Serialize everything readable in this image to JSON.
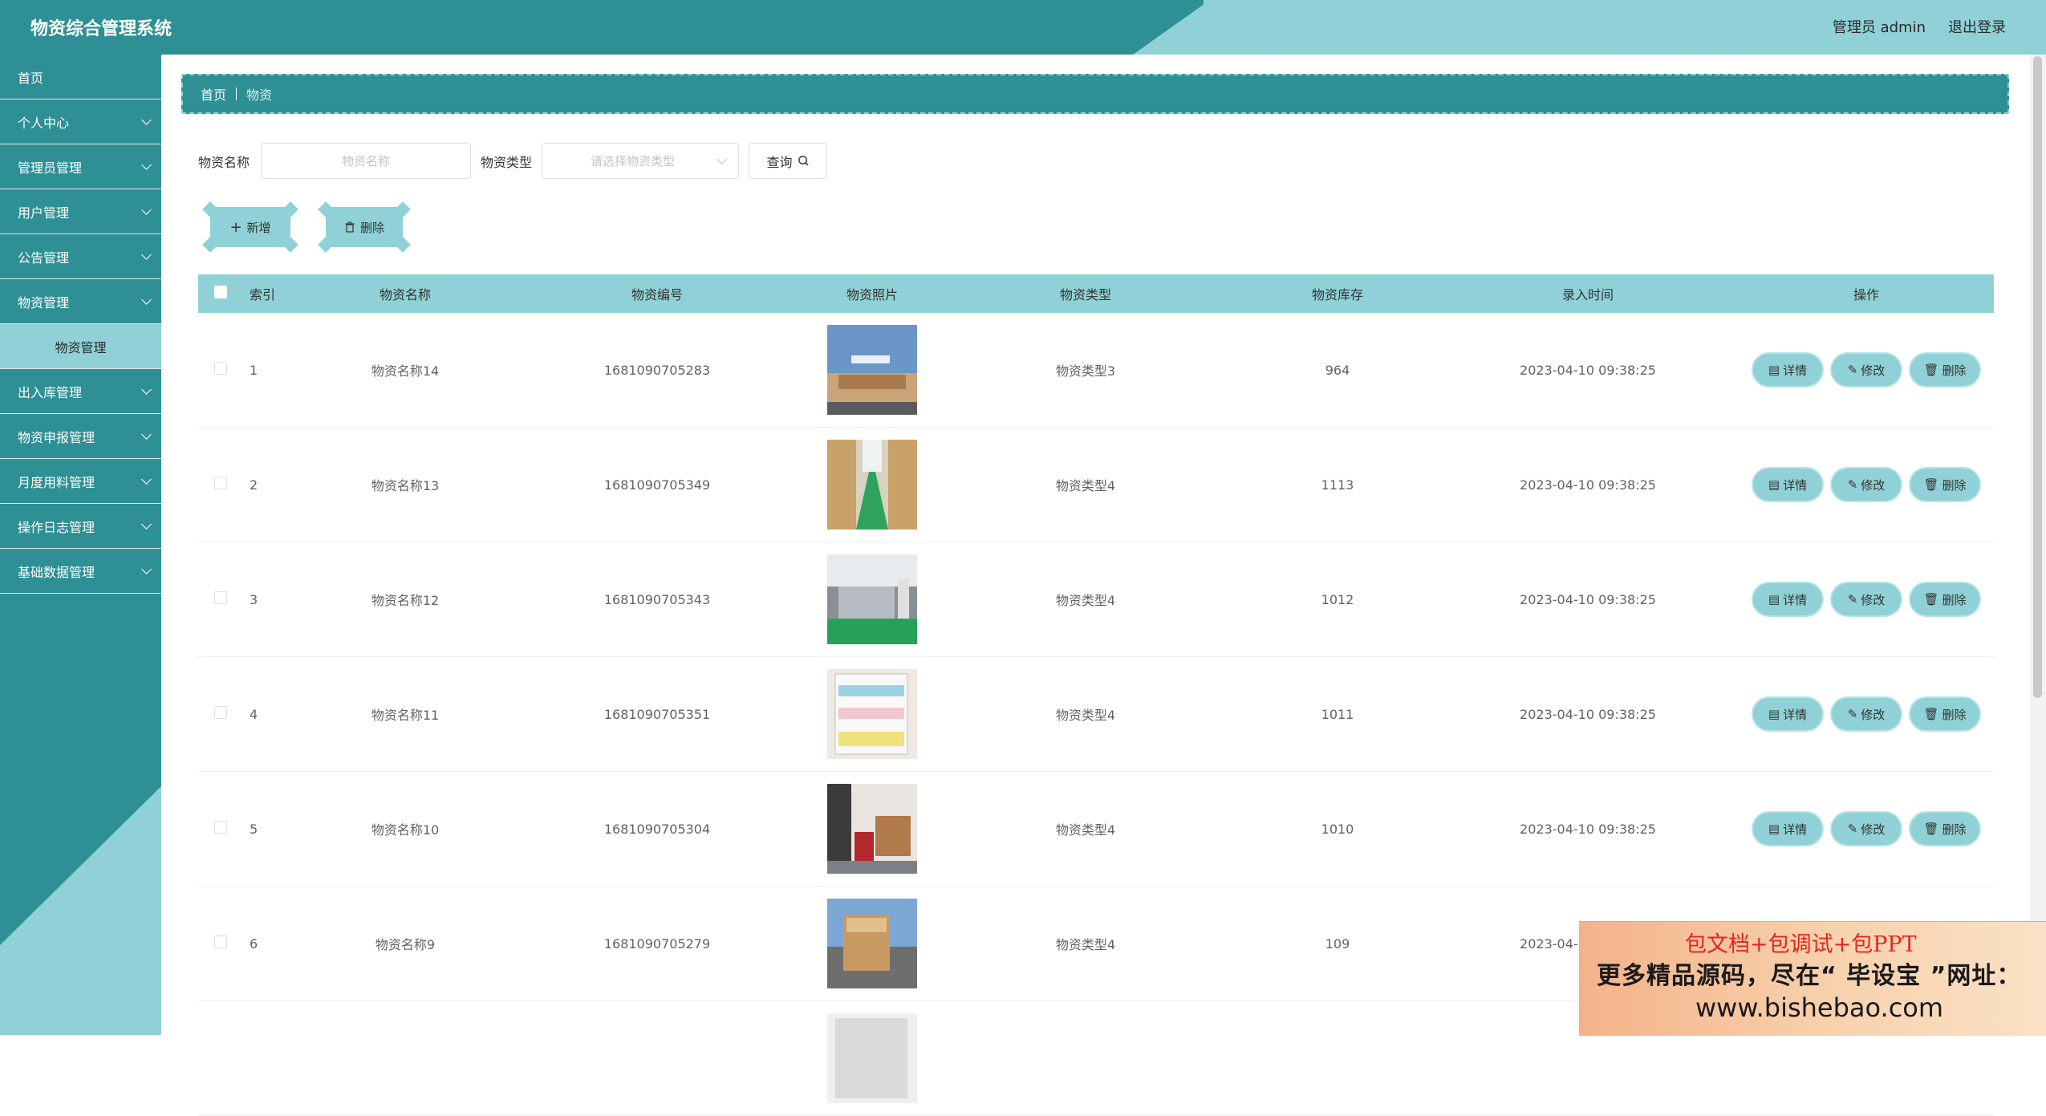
{
  "header": {
    "title": "物资综合管理系统",
    "user": "管理员 admin",
    "logout": "退出登录"
  },
  "sidebar": {
    "items": [
      {
        "label": "首页",
        "chevron": false
      },
      {
        "label": "个人中心",
        "chevron": true
      },
      {
        "label": "管理员管理",
        "chevron": true
      },
      {
        "label": "用户管理",
        "chevron": true
      },
      {
        "label": "公告管理",
        "chevron": true
      },
      {
        "label": "物资管理",
        "chevron": true
      },
      {
        "label": "物资管理",
        "sub": true
      },
      {
        "label": "出入库管理",
        "chevron": true
      },
      {
        "label": "物资申报管理",
        "chevron": true
      },
      {
        "label": "月度用料管理",
        "chevron": true
      },
      {
        "label": "操作日志管理",
        "chevron": true
      },
      {
        "label": "基础数据管理",
        "chevron": true
      }
    ]
  },
  "breadcrumb": {
    "home": "首页",
    "current": "物资"
  },
  "search": {
    "name_label": "物资名称",
    "name_placeholder": "物资名称",
    "type_label": "物资类型",
    "type_placeholder": "请选择物资类型",
    "query": "查询"
  },
  "actions": {
    "add": "新增",
    "delete": "删除"
  },
  "table": {
    "headers": {
      "index": "索引",
      "name": "物资名称",
      "code": "物资编号",
      "photo": "物资照片",
      "type": "物资类型",
      "stock": "物资库存",
      "time": "录入时间",
      "ops": "操作"
    },
    "ops": {
      "detail": "详情",
      "edit": "修改",
      "delete": "删除"
    },
    "rows": [
      {
        "index": "1",
        "name": "物资名称14",
        "code": "1681090705283",
        "type": "物资类型3",
        "stock": "964",
        "time": "2023-04-10 09:38:25"
      },
      {
        "index": "2",
        "name": "物资名称13",
        "code": "1681090705349",
        "type": "物资类型4",
        "stock": "1113",
        "time": "2023-04-10 09:38:25"
      },
      {
        "index": "3",
        "name": "物资名称12",
        "code": "1681090705343",
        "type": "物资类型4",
        "stock": "1012",
        "time": "2023-04-10 09:38:25"
      },
      {
        "index": "4",
        "name": "物资名称11",
        "code": "1681090705351",
        "type": "物资类型4",
        "stock": "1011",
        "time": "2023-04-10 09:38:25"
      },
      {
        "index": "5",
        "name": "物资名称10",
        "code": "1681090705304",
        "type": "物资类型4",
        "stock": "1010",
        "time": "2023-04-10 09:38:25"
      },
      {
        "index": "6",
        "name": "物资名称9",
        "code": "1681090705279",
        "type": "物资类型4",
        "stock": "109",
        "time": "2023-04-10 09:38:25"
      },
      {
        "index": "",
        "name": "",
        "code": "",
        "type": "",
        "stock": "",
        "time": ""
      }
    ]
  },
  "ad": {
    "line1": "包文档+包调试+包PPT",
    "line2": "更多精品源码，尽在“ 毕设宝 ”网址：",
    "line3": "www.bishebao.com"
  },
  "colors": {
    "teal": "#2e9095",
    "light_teal": "#8fd1d6"
  }
}
